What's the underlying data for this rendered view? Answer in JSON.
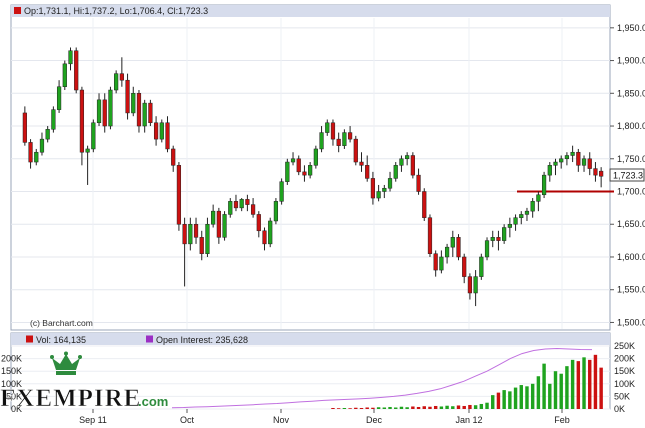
{
  "chart_data": [
    {
      "type": "candlestick",
      "legend": "Op:1,731.1, Hi:1,737.2, Lo:1,706.4, Cl:1,723.3",
      "last_price_label": "1,723.3",
      "credit": "(c) Barchart.com",
      "yticks": [
        "1,500.0",
        "1,550.0",
        "1,600.0",
        "1,650.0",
        "1,700.0",
        "1,750.0",
        "1,800.0",
        "1,850.0",
        "1,900.0",
        "1,950.0"
      ],
      "ylim": [
        1490,
        1965
      ],
      "support_level": 1700,
      "colors": {
        "up": "#1fa31f",
        "down": "#cc1111",
        "support": "#b00000"
      },
      "candles": [
        [
          1820,
          1830,
          1770,
          1775
        ],
        [
          1775,
          1780,
          1735,
          1745
        ],
        [
          1745,
          1765,
          1740,
          1760
        ],
        [
          1760,
          1790,
          1755,
          1780
        ],
        [
          1780,
          1800,
          1775,
          1795
        ],
        [
          1795,
          1830,
          1790,
          1825
        ],
        [
          1825,
          1870,
          1820,
          1860
        ],
        [
          1860,
          1900,
          1855,
          1895
        ],
        [
          1895,
          1920,
          1885,
          1915
        ],
        [
          1915,
          1920,
          1850,
          1855
        ],
        [
          1855,
          1860,
          1740,
          1760
        ],
        [
          1760,
          1770,
          1710,
          1765
        ],
        [
          1765,
          1810,
          1760,
          1805
        ],
        [
          1805,
          1850,
          1800,
          1840
        ],
        [
          1840,
          1850,
          1790,
          1800
        ],
        [
          1800,
          1860,
          1795,
          1855
        ],
        [
          1855,
          1885,
          1850,
          1880
        ],
        [
          1880,
          1905,
          1860,
          1870
        ],
        [
          1870,
          1880,
          1810,
          1820
        ],
        [
          1820,
          1860,
          1815,
          1850
        ],
        [
          1850,
          1855,
          1790,
          1800
        ],
        [
          1800,
          1840,
          1790,
          1835
        ],
        [
          1835,
          1840,
          1800,
          1805
        ],
        [
          1805,
          1815,
          1770,
          1780
        ],
        [
          1780,
          1810,
          1775,
          1805
        ],
        [
          1805,
          1815,
          1760,
          1765
        ],
        [
          1765,
          1770,
          1730,
          1740
        ],
        [
          1740,
          1745,
          1640,
          1650
        ],
        [
          1650,
          1660,
          1555,
          1620
        ],
        [
          1620,
          1660,
          1610,
          1650
        ],
        [
          1650,
          1660,
          1620,
          1630
        ],
        [
          1630,
          1640,
          1595,
          1605
        ],
        [
          1605,
          1660,
          1600,
          1650
        ],
        [
          1650,
          1680,
          1645,
          1670
        ],
        [
          1670,
          1675,
          1620,
          1630
        ],
        [
          1630,
          1670,
          1625,
          1665
        ],
        [
          1665,
          1690,
          1660,
          1685
        ],
        [
          1685,
          1695,
          1670,
          1675
        ],
        [
          1675,
          1690,
          1670,
          1688
        ],
        [
          1688,
          1695,
          1670,
          1680
        ],
        [
          1680,
          1690,
          1660,
          1665
        ],
        [
          1665,
          1670,
          1630,
          1640
        ],
        [
          1640,
          1645,
          1610,
          1620
        ],
        [
          1620,
          1660,
          1615,
          1655
        ],
        [
          1655,
          1690,
          1650,
          1685
        ],
        [
          1685,
          1720,
          1680,
          1715
        ],
        [
          1715,
          1750,
          1710,
          1745
        ],
        [
          1745,
          1760,
          1740,
          1750
        ],
        [
          1750,
          1755,
          1725,
          1730
        ],
        [
          1730,
          1740,
          1715,
          1725
        ],
        [
          1725,
          1745,
          1720,
          1740
        ],
        [
          1740,
          1770,
          1735,
          1765
        ],
        [
          1765,
          1800,
          1760,
          1790
        ],
        [
          1790,
          1810,
          1785,
          1805
        ],
        [
          1805,
          1810,
          1770,
          1780
        ],
        [
          1780,
          1790,
          1760,
          1770
        ],
        [
          1770,
          1795,
          1765,
          1790
        ],
        [
          1790,
          1800,
          1775,
          1780
        ],
        [
          1780,
          1785,
          1740,
          1745
        ],
        [
          1745,
          1760,
          1730,
          1740
        ],
        [
          1740,
          1755,
          1715,
          1720
        ],
        [
          1720,
          1730,
          1680,
          1690
        ],
        [
          1690,
          1710,
          1685,
          1700
        ],
        [
          1700,
          1710,
          1690,
          1705
        ],
        [
          1705,
          1730,
          1700,
          1720
        ],
        [
          1720,
          1745,
          1715,
          1740
        ],
        [
          1740,
          1755,
          1730,
          1750
        ],
        [
          1750,
          1760,
          1740,
          1755
        ],
        [
          1755,
          1760,
          1720,
          1725
        ],
        [
          1725,
          1735,
          1695,
          1700
        ],
        [
          1700,
          1705,
          1655,
          1660
        ],
        [
          1660,
          1665,
          1600,
          1605
        ],
        [
          1605,
          1610,
          1570,
          1580
        ],
        [
          1580,
          1610,
          1575,
          1600
        ],
        [
          1600,
          1620,
          1590,
          1615
        ],
        [
          1615,
          1640,
          1600,
          1630
        ],
        [
          1630,
          1635,
          1595,
          1600
        ],
        [
          1600,
          1605,
          1560,
          1570
        ],
        [
          1570,
          1575,
          1535,
          1545
        ],
        [
          1545,
          1580,
          1525,
          1570
        ],
        [
          1570,
          1605,
          1565,
          1600
        ],
        [
          1600,
          1630,
          1595,
          1625
        ],
        [
          1625,
          1640,
          1615,
          1630
        ],
        [
          1630,
          1640,
          1610,
          1625
        ],
        [
          1625,
          1650,
          1620,
          1645
        ],
        [
          1645,
          1660,
          1630,
          1650
        ],
        [
          1650,
          1665,
          1640,
          1660
        ],
        [
          1660,
          1670,
          1650,
          1665
        ],
        [
          1665,
          1675,
          1655,
          1670
        ],
        [
          1670,
          1690,
          1660,
          1685
        ],
        [
          1685,
          1700,
          1670,
          1695
        ],
        [
          1695,
          1730,
          1690,
          1725
        ],
        [
          1725,
          1745,
          1715,
          1740
        ],
        [
          1740,
          1750,
          1725,
          1745
        ],
        [
          1745,
          1755,
          1735,
          1750
        ],
        [
          1750,
          1760,
          1740,
          1755
        ],
        [
          1755,
          1770,
          1745,
          1760
        ],
        [
          1760,
          1765,
          1730,
          1740
        ],
        [
          1740,
          1755,
          1730,
          1750
        ],
        [
          1750,
          1760,
          1725,
          1735
        ],
        [
          1735,
          1745,
          1715,
          1725
        ],
        [
          1731.1,
          1737.2,
          1706.4,
          1723.3
        ]
      ]
    },
    {
      "type": "bar",
      "legend_vol": "Vol: 164,135",
      "legend_oi": "Open Interest: 235,628",
      "yticks_left": [
        "0K",
        "50K",
        "100K",
        "150K",
        "200K"
      ],
      "yticks_right": [
        "0K",
        "50K",
        "100K",
        "150K",
        "200K",
        "250K"
      ],
      "ylim": [
        0,
        250000
      ],
      "colors": {
        "up": "#1fa31f",
        "down": "#cc1111",
        "oi": "#c070e0"
      },
      "volume": [
        4000,
        3000,
        4000,
        3000,
        5000,
        4000,
        6000,
        5000,
        7000,
        6000,
        8000,
        6000,
        9000,
        7000,
        10000,
        8000,
        11000,
        9000,
        12000,
        10000,
        13000,
        11000,
        14000,
        12000,
        16000,
        15000,
        20000,
        25000,
        55000,
        65000,
        75000,
        70000,
        85000,
        95000,
        90000,
        100000,
        130000,
        180000,
        100000,
        150000,
        140000,
        170000,
        195000,
        190000,
        205000,
        195000,
        215000,
        164135
      ],
      "open_interest": [
        5000,
        6000,
        8000,
        9000,
        11000,
        13000,
        15000,
        17000,
        20000,
        22000,
        25000,
        28000,
        31000,
        34000,
        36000,
        38000,
        40000,
        43000,
        46000,
        50000,
        55000,
        62000,
        70000,
        80000,
        95000,
        110000,
        130000,
        150000,
        175000,
        200000,
        220000,
        232000,
        238000,
        240000,
        238000,
        236000,
        235628
      ]
    }
  ],
  "xaxis": {
    "labels": [
      "Sep 11",
      "Oct",
      "Nov",
      "Dec",
      "Jan 12",
      "Feb"
    ]
  },
  "watermark": {
    "main": "FXEMPIRE",
    "suffix": ".com"
  }
}
